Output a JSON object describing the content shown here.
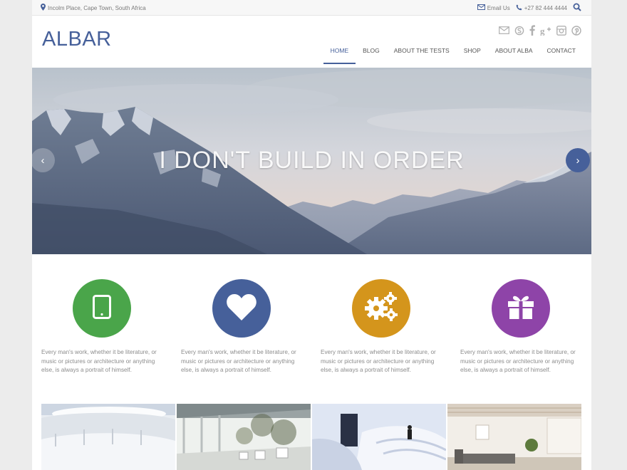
{
  "topbar": {
    "location": "Incolm Place, Cape Town, South Africa",
    "email": "Email Us",
    "phone": "+27 82 444 4444"
  },
  "header": {
    "logo": "ALBAR",
    "social": [
      "mail-icon",
      "skype-icon",
      "facebook-icon",
      "google-plus-icon",
      "instagram-icon",
      "pinterest-icon"
    ]
  },
  "nav": {
    "items": [
      {
        "label": "HOME",
        "active": true
      },
      {
        "label": "BLOG"
      },
      {
        "label": "ABOUT THE TESTS"
      },
      {
        "label": "SHOP"
      },
      {
        "label": "ABOUT ALBA"
      },
      {
        "label": "CONTACT"
      }
    ]
  },
  "slider": {
    "title": "I DON'T BUILD IN ORDER",
    "prev": "‹",
    "next": "›"
  },
  "features": [
    {
      "icon": "tablet-icon",
      "color": "#4aa54a",
      "text": "Every man's work, whether it be literature, or music or pictures or architecture or anything else, is always a portrait of himself."
    },
    {
      "icon": "heart-icon",
      "color": "#46609a",
      "text": "Every man's work, whether it be literature, or music or pictures or architecture or anything else, is always a portrait of himself."
    },
    {
      "icon": "gears-icon",
      "color": "#d4951c",
      "text": "Every man's work, whether it be literature, or music or pictures or architecture or anything else, is always a portrait of himself."
    },
    {
      "icon": "gift-icon",
      "color": "#8e44a8",
      "text": "Every man's work, whether it be literature, or music or pictures or architecture or anything else, is always a portrait of himself."
    }
  ],
  "colors": {
    "accent": "#46609a"
  }
}
